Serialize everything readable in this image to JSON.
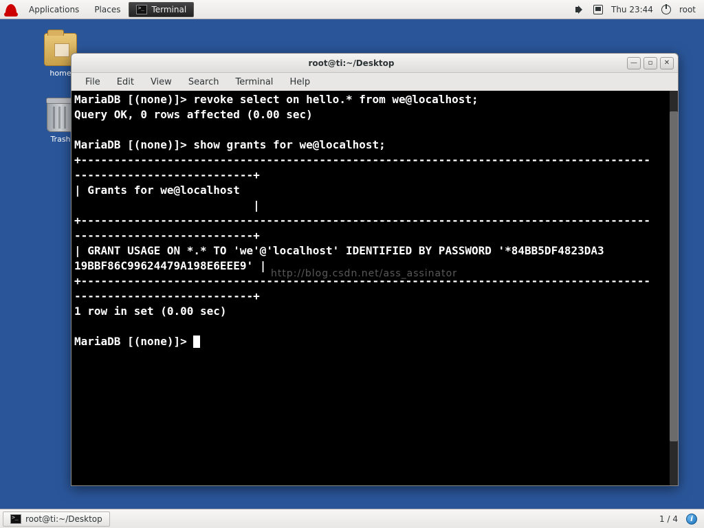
{
  "panel": {
    "applications": "Applications",
    "places": "Places",
    "terminal_task": "Terminal",
    "clock": "Thu 23:44",
    "user": "root"
  },
  "desktop": {
    "home_label": "home",
    "trash_label": "Trash"
  },
  "window": {
    "title": "root@ti:~/Desktop",
    "menus": {
      "file": "File",
      "edit": "Edit",
      "view": "View",
      "search": "Search",
      "terminal": "Terminal",
      "help": "Help"
    }
  },
  "terminal": {
    "line1": "MariaDB [(none)]> revoke select on hello.* from we@localhost;",
    "line2": "Query OK, 0 rows affected (0.00 sec)",
    "blank1": "",
    "line3": "MariaDB [(none)]> show grants for we@localhost;",
    "sep1a": "+--------------------------------------------------------------------------------------",
    "sep1b": "---------------------------+",
    "header1": "| Grants for we@localhost                                                              ",
    "header2": "                           |",
    "sep2a": "+--------------------------------------------------------------------------------------",
    "sep2b": "---------------------------+",
    "row1a": "| GRANT USAGE ON *.* TO 'we'@'localhost' IDENTIFIED BY PASSWORD '*84BB5DF4823DA3",
    "row1b": "19BBF86C99624479A198E6EEE9' |",
    "sep3a": "+--------------------------------------------------------------------------------------",
    "sep3b": "---------------------------+",
    "footer": "1 row in set (0.00 sec)",
    "blank2": "",
    "prompt": "MariaDB [(none)]> ",
    "watermark": "http://blog.csdn.net/ass_assinator"
  },
  "bottom": {
    "task_label": "root@ti:~/Desktop",
    "workspace": "1 / 4"
  }
}
